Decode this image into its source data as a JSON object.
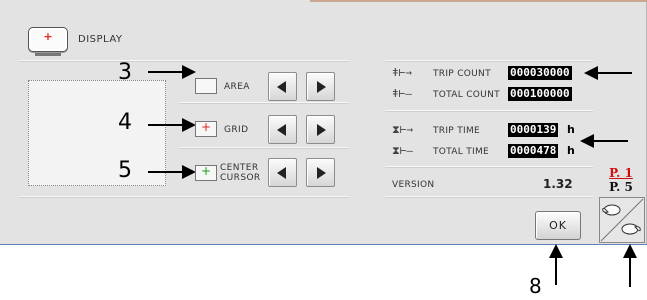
{
  "header": {
    "title": "DISPLAY",
    "icon": "embroidery-frame-icon"
  },
  "settings": [
    {
      "callout": "3",
      "label": "AREA",
      "symbol": ""
    },
    {
      "callout": "4",
      "label": "GRID",
      "symbol": "+"
    },
    {
      "callout": "5",
      "label_line1": "CENTER",
      "label_line2": "CURSOR",
      "symbol": "+"
    }
  ],
  "counters": {
    "trip_count": {
      "label": "TRIP COUNT",
      "value": "000030000"
    },
    "total_count": {
      "label": "TOTAL COUNT",
      "value": "000100000"
    },
    "trip_time": {
      "label": "TRIP TIME",
      "value": "0000139",
      "unit": "h"
    },
    "total_time": {
      "label": "TOTAL TIME",
      "value": "0000478",
      "unit": "h"
    }
  },
  "version": {
    "label": "VERSION",
    "value": "1.32"
  },
  "ok_label": "OK",
  "pagination": {
    "current": "P. 1",
    "total": "P. 5"
  },
  "callouts": {
    "ok": "8"
  },
  "colors": {
    "grid_plus": "#e52020",
    "cursor_plus": "#1aa01a",
    "page_current": "#d01010"
  }
}
